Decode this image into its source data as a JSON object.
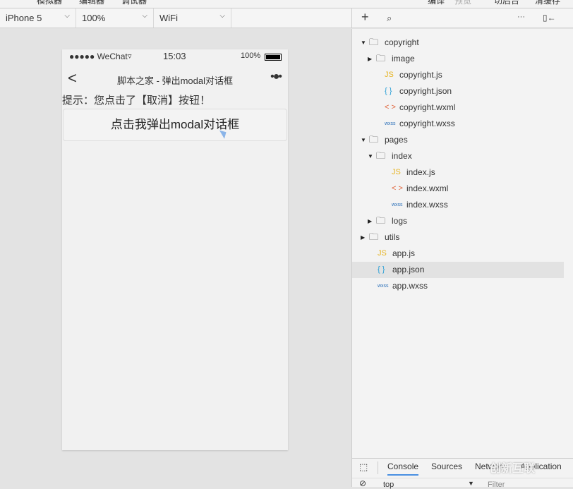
{
  "menubar": {
    "items": [
      "模拟器",
      "编辑器",
      "调试器",
      "编译",
      "预览",
      "切后台",
      "清缓存"
    ]
  },
  "toolbar": {
    "device": "iPhone 5",
    "zoom": "100%",
    "network": "WiFi",
    "add_icon": "plus-icon",
    "search_icon": "search-icon",
    "more": "···",
    "collapse_icon": "panel-collapse-icon"
  },
  "phone": {
    "status": {
      "carrier": "●●●●● WeChat",
      "time": "15:03",
      "battery": "100%"
    },
    "nav": {
      "title": "脚本之家 - 弹出modal对话框",
      "back": "<",
      "menu": "•●•"
    },
    "tip": "提示：您点击了【取消】按钮！",
    "button": "点击我弹出modal对话框"
  },
  "tree": [
    {
      "label": "copyright",
      "type": "folder",
      "open": true,
      "depth": 0
    },
    {
      "label": "image",
      "type": "folder",
      "open": false,
      "depth": 1
    },
    {
      "label": "copyright.js",
      "type": "js",
      "depth": 1
    },
    {
      "label": "copyright.json",
      "type": "json",
      "depth": 1
    },
    {
      "label": "copyright.wxml",
      "type": "wxml",
      "depth": 1
    },
    {
      "label": "copyright.wxss",
      "type": "wxss",
      "depth": 1
    },
    {
      "label": "pages",
      "type": "folder",
      "open": true,
      "depth": 0
    },
    {
      "label": "index",
      "type": "folder",
      "open": true,
      "depth": 1
    },
    {
      "label": "index.js",
      "type": "js",
      "depth": 2
    },
    {
      "label": "index.wxml",
      "type": "wxml",
      "depth": 2
    },
    {
      "label": "index.wxss",
      "type": "wxss",
      "depth": 2
    },
    {
      "label": "logs",
      "type": "folder",
      "open": false,
      "depth": 1
    },
    {
      "label": "utils",
      "type": "folder",
      "open": false,
      "depth": 0
    },
    {
      "label": "app.js",
      "type": "js",
      "depth": 0
    },
    {
      "label": "app.json",
      "type": "json",
      "depth": 0,
      "selected": true
    },
    {
      "label": "app.wxss",
      "type": "wxss",
      "depth": 0
    }
  ],
  "devtools": {
    "tabs": [
      "Console",
      "Sources",
      "Network",
      "Application"
    ],
    "active": "Console",
    "context": "top",
    "filter_placeholder": "Filter"
  },
  "watermark": "创新互联",
  "colors": {
    "js": "#e6b422",
    "json": "#2a9fd6",
    "wxml": "#e0643a",
    "wxss": "#2a6fb8"
  }
}
